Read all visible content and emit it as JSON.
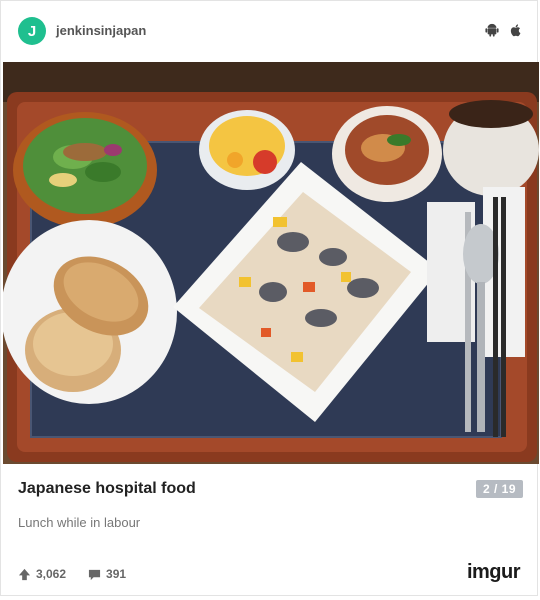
{
  "header": {
    "avatar_letter": "J",
    "username": "jenkinsinjapan",
    "platform_icons": [
      "android-icon",
      "apple-icon"
    ]
  },
  "post": {
    "image_alt": "Hospital lunch tray",
    "title": "Japanese hospital food",
    "counter": "2 / 19",
    "description": "Lunch while in labour"
  },
  "stats": {
    "upvotes": "3,062",
    "comments": "391"
  },
  "brand": {
    "logo_text": "imgur"
  },
  "colors": {
    "avatar_bg": "#1fbf8f",
    "counter_bg": "#b6bbc2",
    "brand_accent": "#1bb76e"
  }
}
